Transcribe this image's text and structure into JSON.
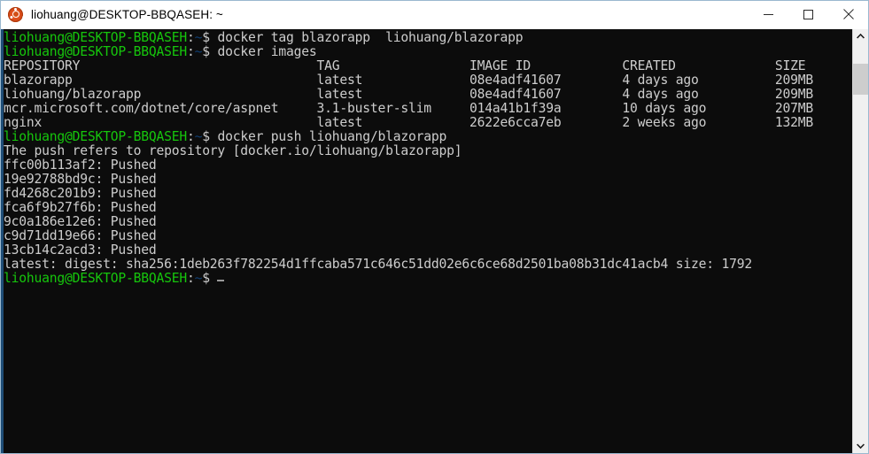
{
  "window": {
    "title": "liohuang@DESKTOP-BBQASEH: ~",
    "icon": "ubuntu-icon",
    "controls": {
      "minimize_label": "Minimize",
      "maximize_label": "Maximize",
      "close_label": "Close"
    }
  },
  "terminal": {
    "prompt": {
      "userhost": "liohuang@DESKTOP-BBQASEH",
      "colon": ":",
      "path": "~",
      "sigil": "$"
    },
    "colors": {
      "background": "#0c0c0c",
      "foreground": "#cccccc",
      "prompt_green": "#16c60c",
      "prompt_blue": "#0f3d70",
      "cursor": "#9a9a9a",
      "left_edge": "#1f4d77"
    },
    "commands": {
      "tag": " docker tag blazorapp  liohuang/blazorapp",
      "images": " docker images",
      "push": " docker push liohuang/blazorapp"
    },
    "images_table": {
      "headers": "REPOSITORY                               TAG                 IMAGE ID            CREATED             SIZE",
      "rows": [
        "blazorapp                                latest              08e4adf41607        4 days ago          209MB",
        "liohuang/blazorapp                       latest              08e4adf41607        4 days ago          209MB",
        "mcr.microsoft.com/dotnet/core/aspnet     3.1-buster-slim     014a41b1f39a        10 days ago         207MB",
        "nginx                                    latest              2622e6cca7eb        2 weeks ago         132MB"
      ]
    },
    "push_output": {
      "refers": "The push refers to repository [docker.io/liohuang/blazorapp]",
      "layers": [
        "ffc00b113af2: Pushed",
        "19e92788bd9c: Pushed",
        "fd4268c201b9: Pushed",
        "fca6f9b27f6b: Pushed",
        "9c0a186e12e6: Pushed",
        "c9d71dd19e66: Pushed",
        "13cb14c2acd3: Pushed"
      ],
      "digest": "latest: digest: sha256:1deb263f782254d1ffcaba571c646c51dd02e6c6ce68d2501ba08b31dc41acb4 size: 1792"
    }
  },
  "scrollbar": {
    "up_arrow": "chevron-up-icon",
    "down_arrow": "chevron-down-icon"
  }
}
